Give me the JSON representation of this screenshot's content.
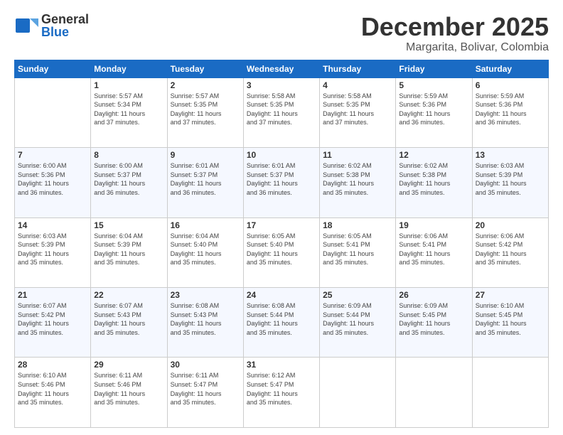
{
  "header": {
    "logo_line1": "General",
    "logo_line2": "Blue",
    "month": "December 2025",
    "location": "Margarita, Bolivar, Colombia"
  },
  "days_of_week": [
    "Sunday",
    "Monday",
    "Tuesday",
    "Wednesday",
    "Thursday",
    "Friday",
    "Saturday"
  ],
  "weeks": [
    [
      {
        "day": "",
        "info": ""
      },
      {
        "day": "1",
        "info": "Sunrise: 5:57 AM\nSunset: 5:34 PM\nDaylight: 11 hours\nand 37 minutes."
      },
      {
        "day": "2",
        "info": "Sunrise: 5:57 AM\nSunset: 5:35 PM\nDaylight: 11 hours\nand 37 minutes."
      },
      {
        "day": "3",
        "info": "Sunrise: 5:58 AM\nSunset: 5:35 PM\nDaylight: 11 hours\nand 37 minutes."
      },
      {
        "day": "4",
        "info": "Sunrise: 5:58 AM\nSunset: 5:35 PM\nDaylight: 11 hours\nand 37 minutes."
      },
      {
        "day": "5",
        "info": "Sunrise: 5:59 AM\nSunset: 5:36 PM\nDaylight: 11 hours\nand 36 minutes."
      },
      {
        "day": "6",
        "info": "Sunrise: 5:59 AM\nSunset: 5:36 PM\nDaylight: 11 hours\nand 36 minutes."
      }
    ],
    [
      {
        "day": "7",
        "info": "Sunrise: 6:00 AM\nSunset: 5:36 PM\nDaylight: 11 hours\nand 36 minutes."
      },
      {
        "day": "8",
        "info": "Sunrise: 6:00 AM\nSunset: 5:37 PM\nDaylight: 11 hours\nand 36 minutes."
      },
      {
        "day": "9",
        "info": "Sunrise: 6:01 AM\nSunset: 5:37 PM\nDaylight: 11 hours\nand 36 minutes."
      },
      {
        "day": "10",
        "info": "Sunrise: 6:01 AM\nSunset: 5:37 PM\nDaylight: 11 hours\nand 36 minutes."
      },
      {
        "day": "11",
        "info": "Sunrise: 6:02 AM\nSunset: 5:38 PM\nDaylight: 11 hours\nand 35 minutes."
      },
      {
        "day": "12",
        "info": "Sunrise: 6:02 AM\nSunset: 5:38 PM\nDaylight: 11 hours\nand 35 minutes."
      },
      {
        "day": "13",
        "info": "Sunrise: 6:03 AM\nSunset: 5:39 PM\nDaylight: 11 hours\nand 35 minutes."
      }
    ],
    [
      {
        "day": "14",
        "info": "Sunrise: 6:03 AM\nSunset: 5:39 PM\nDaylight: 11 hours\nand 35 minutes."
      },
      {
        "day": "15",
        "info": "Sunrise: 6:04 AM\nSunset: 5:39 PM\nDaylight: 11 hours\nand 35 minutes."
      },
      {
        "day": "16",
        "info": "Sunrise: 6:04 AM\nSunset: 5:40 PM\nDaylight: 11 hours\nand 35 minutes."
      },
      {
        "day": "17",
        "info": "Sunrise: 6:05 AM\nSunset: 5:40 PM\nDaylight: 11 hours\nand 35 minutes."
      },
      {
        "day": "18",
        "info": "Sunrise: 6:05 AM\nSunset: 5:41 PM\nDaylight: 11 hours\nand 35 minutes."
      },
      {
        "day": "19",
        "info": "Sunrise: 6:06 AM\nSunset: 5:41 PM\nDaylight: 11 hours\nand 35 minutes."
      },
      {
        "day": "20",
        "info": "Sunrise: 6:06 AM\nSunset: 5:42 PM\nDaylight: 11 hours\nand 35 minutes."
      }
    ],
    [
      {
        "day": "21",
        "info": "Sunrise: 6:07 AM\nSunset: 5:42 PM\nDaylight: 11 hours\nand 35 minutes."
      },
      {
        "day": "22",
        "info": "Sunrise: 6:07 AM\nSunset: 5:43 PM\nDaylight: 11 hours\nand 35 minutes."
      },
      {
        "day": "23",
        "info": "Sunrise: 6:08 AM\nSunset: 5:43 PM\nDaylight: 11 hours\nand 35 minutes."
      },
      {
        "day": "24",
        "info": "Sunrise: 6:08 AM\nSunset: 5:44 PM\nDaylight: 11 hours\nand 35 minutes."
      },
      {
        "day": "25",
        "info": "Sunrise: 6:09 AM\nSunset: 5:44 PM\nDaylight: 11 hours\nand 35 minutes."
      },
      {
        "day": "26",
        "info": "Sunrise: 6:09 AM\nSunset: 5:45 PM\nDaylight: 11 hours\nand 35 minutes."
      },
      {
        "day": "27",
        "info": "Sunrise: 6:10 AM\nSunset: 5:45 PM\nDaylight: 11 hours\nand 35 minutes."
      }
    ],
    [
      {
        "day": "28",
        "info": "Sunrise: 6:10 AM\nSunset: 5:46 PM\nDaylight: 11 hours\nand 35 minutes."
      },
      {
        "day": "29",
        "info": "Sunrise: 6:11 AM\nSunset: 5:46 PM\nDaylight: 11 hours\nand 35 minutes."
      },
      {
        "day": "30",
        "info": "Sunrise: 6:11 AM\nSunset: 5:47 PM\nDaylight: 11 hours\nand 35 minutes."
      },
      {
        "day": "31",
        "info": "Sunrise: 6:12 AM\nSunset: 5:47 PM\nDaylight: 11 hours\nand 35 minutes."
      },
      {
        "day": "",
        "info": ""
      },
      {
        "day": "",
        "info": ""
      },
      {
        "day": "",
        "info": ""
      }
    ]
  ]
}
